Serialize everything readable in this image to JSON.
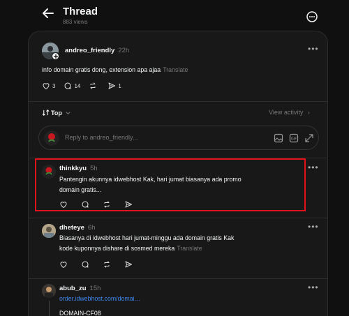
{
  "header": {
    "title": "Thread",
    "views": "883 views"
  },
  "post": {
    "author": "andreo_friendly",
    "time": "22h",
    "text": "info domain gratis dong, extension apa ajaa",
    "translate": "Translate",
    "likes": "3",
    "replies": "14",
    "shares": "1"
  },
  "sort": {
    "label": "Top",
    "view_activity": "View activity"
  },
  "reply_box": {
    "placeholder": "Reply to andreo_friendly..."
  },
  "comments": [
    {
      "author": "thinkkyu",
      "time": "5h",
      "line1": "Pantengin akunnya idwebhost Kak, hari jumat biasanya ada promo",
      "line2": "domain gratis..."
    },
    {
      "author": "dheteye",
      "time": "6h",
      "line1": "Biasanya di idwebhost hari jumat-minggu ada domain gratis Kak",
      "line2": "kode kuponnya dishare di sosmed mereka",
      "translate": "Translate"
    },
    {
      "author": "abub_zu",
      "time": "15h",
      "link": "order.idwebhost.com/domai…",
      "line2": "DOMAIN-CF08"
    }
  ],
  "colors": {
    "background": "#101010",
    "panel": "#181818",
    "highlight": "#e0121c",
    "link": "#3f88ee"
  },
  "icons": [
    "back-arrow-icon",
    "more-circle-icon",
    "heart-icon",
    "comment-icon",
    "repost-icon",
    "share-icon",
    "gif-icon",
    "image-icon",
    "expand-icon"
  ]
}
